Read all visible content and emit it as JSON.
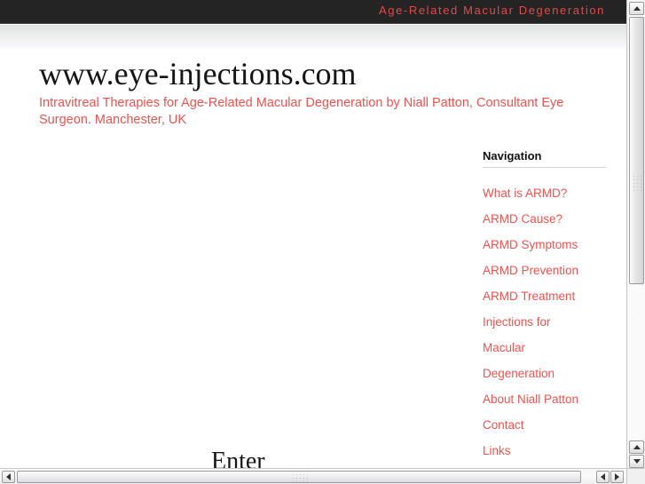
{
  "banner": {
    "title": "Age-Related Macular Degeneration",
    "background_color": "#242424",
    "text_color": "#e04a4a"
  },
  "page": {
    "site_title": "www.eye-injections.com",
    "tagline": "Intravitreal Therapies for Age-Related Macular Degeneration by Niall Patton, Consultant Eye Surgeon. Manchester, UK",
    "enter_label": "Enter",
    "link_color": "#ef5350",
    "heading_color": "#161616"
  },
  "navigation": {
    "heading": "Navigation",
    "items": [
      {
        "label": "What is ARMD?"
      },
      {
        "label": "ARMD Cause?"
      },
      {
        "label": "ARMD Symptoms"
      },
      {
        "label": "ARMD Prevention"
      },
      {
        "label": "ARMD Treatment"
      },
      {
        "label": "Injections for"
      },
      {
        "label": "Macular"
      },
      {
        "label": "Degeneration"
      },
      {
        "label": "About Niall Patton"
      },
      {
        "label": "Contact"
      },
      {
        "label": "Links"
      }
    ]
  },
  "scrollbars": {
    "vertical": {
      "up_arrow": "▲",
      "down_arrow": "▼"
    },
    "horizontal": {
      "left_arrow": "◀",
      "right_arrow": "▶"
    }
  }
}
